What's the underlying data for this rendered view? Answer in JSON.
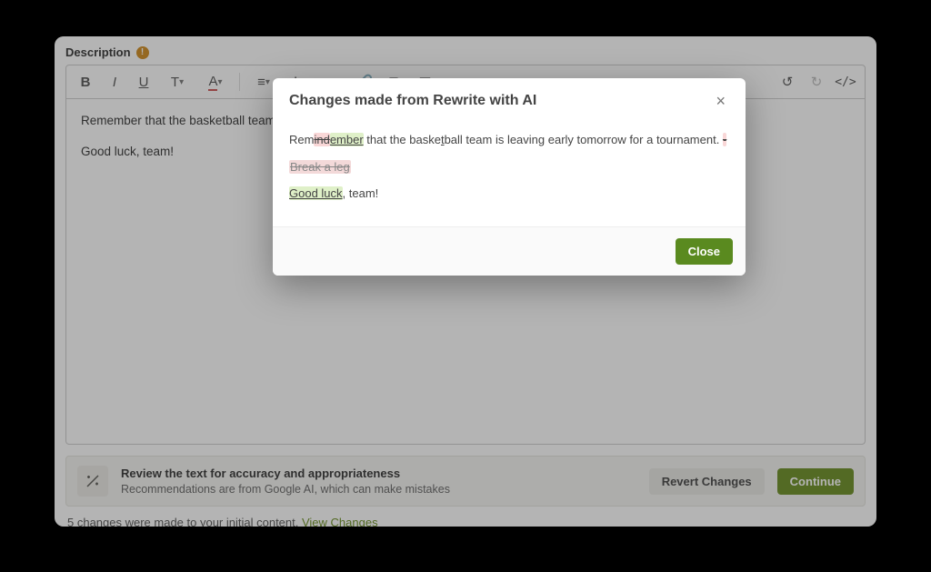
{
  "header": {
    "label": "Description",
    "badge": "!"
  },
  "toolbar": {
    "bold": "B",
    "italic": "I",
    "underline": "U",
    "textSize": "T",
    "textColor": "A",
    "align": "≡",
    "list": "⋮≡",
    "indent": "→≡",
    "link": "🔗",
    "image": "▢",
    "table": "▦",
    "hr": "—",
    "undo": "↺",
    "redo": "↻",
    "code": "</>"
  },
  "editor": {
    "p1": "Remember that the basketball team is leaving early tomorrow for a tournament.",
    "p2": "Good luck, team!"
  },
  "reviewBar": {
    "icon": "✦",
    "title": "Review the text for accuracy and appropriateness",
    "subtitle": "Recommendations are from Google AI, which can make mistakes",
    "revert": "Revert Changes",
    "continue": "Continue"
  },
  "status": {
    "text": "5 changes were made to your initial content. ",
    "link": "View Changes"
  },
  "modal": {
    "title": "Changes made from Rewrite with AI",
    "line1": {
      "prefix": "Rem",
      "del1": "ind",
      "ins1": "ember",
      "mid": " that the baske",
      "u": "t",
      "suffix": "ball team is leaving early tomorrow for a tournament. ",
      "trailDel": "-"
    },
    "line2": "Break a leg",
    "line3": {
      "ins": "Good luck",
      "rest": ", team!"
    },
    "close": "Close"
  }
}
